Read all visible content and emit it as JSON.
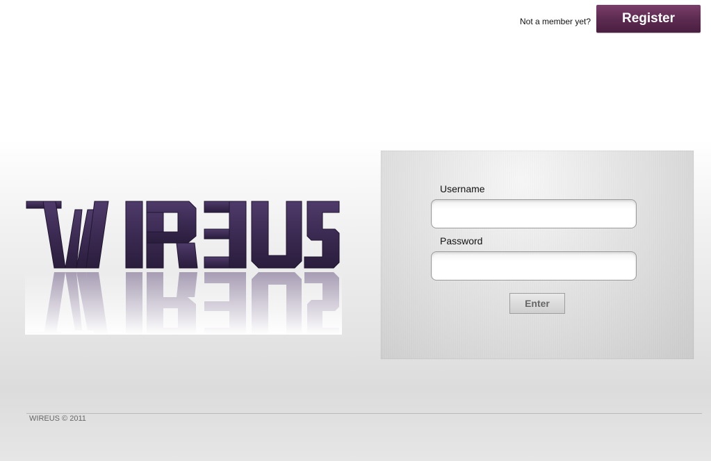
{
  "header": {
    "prompt_text": "Not a member yet?",
    "register_label": "Register"
  },
  "logo": {
    "text": "WIREUS",
    "color": "#3b2a52"
  },
  "login": {
    "username_label": "Username",
    "username_value": "",
    "password_label": "Password",
    "password_value": "",
    "enter_label": "Enter"
  },
  "footer": {
    "copyright": "WIREUS © 2011"
  },
  "colors": {
    "accent": "#5d2b52",
    "logo": "#3b2a52"
  }
}
